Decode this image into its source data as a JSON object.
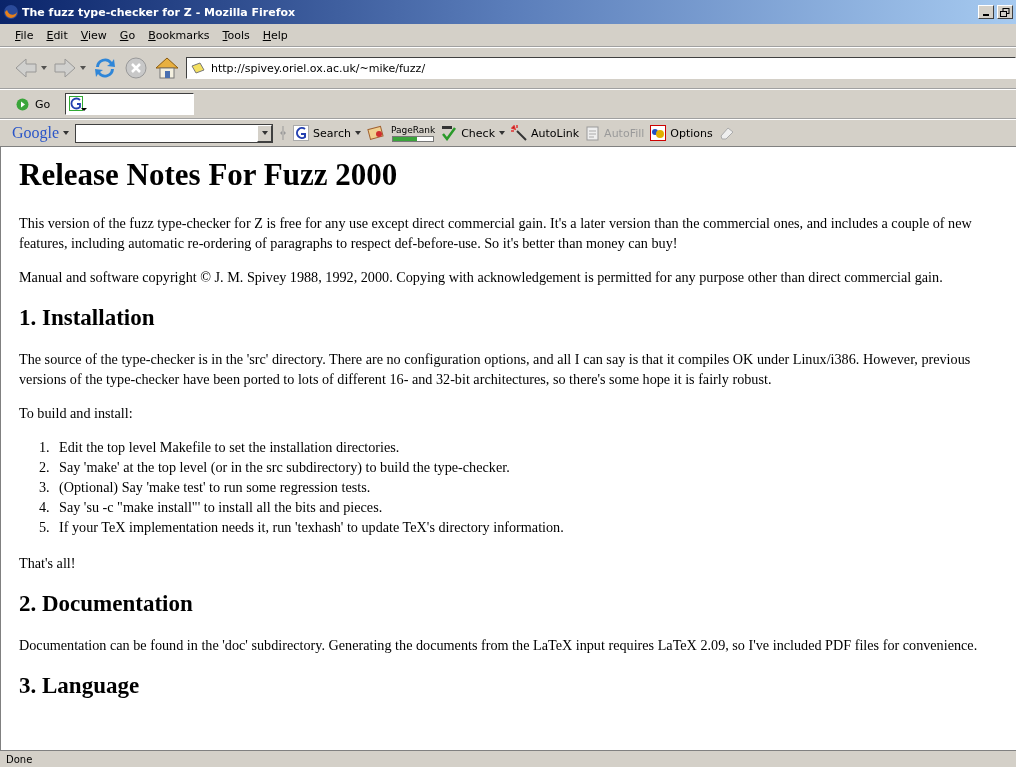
{
  "window": {
    "title": "The fuzz type-checker for Z - Mozilla Firefox"
  },
  "menu": [
    "File",
    "Edit",
    "View",
    "Go",
    "Bookmarks",
    "Tools",
    "Help"
  ],
  "navigation": {
    "back": {
      "disabled": true
    },
    "forward": {
      "disabled": true
    },
    "stop": {
      "disabled": true
    },
    "address": "http://spivey.oriel.ox.ac.uk/~mike/fuzz/"
  },
  "go_bar": {
    "go": "Go"
  },
  "google_toolbar": {
    "logo": "Google",
    "search": "Search",
    "pagerank": {
      "label": "PageRank",
      "level": 0.6
    },
    "buttons": [
      {
        "label": "Check",
        "kind": "check",
        "disabled": false,
        "menu": true
      },
      {
        "label": "AutoLink",
        "kind": "autolink",
        "disabled": false,
        "menu": false
      },
      {
        "label": "AutoFill",
        "kind": "autofill",
        "disabled": true,
        "menu": false
      },
      {
        "label": "Options",
        "kind": "options",
        "disabled": false,
        "menu": false
      }
    ]
  },
  "page": {
    "title": "Release Notes For Fuzz 2000",
    "blocks": [
      {
        "kind": "p",
        "text": "This version of the fuzz type-checker for Z is free for any use except direct commercial gain. It's a later version than the commercial ones, and includes a couple of new features, including automatic re-ordering of paragraphs to respect def-before-use. So it's better than money can buy!"
      },
      {
        "kind": "p",
        "text": "Manual and software copyright © J. M. Spivey 1988, 1992, 2000. Copying with acknowledgement is permitted for any purpose other than direct commercial gain."
      },
      {
        "kind": "h2",
        "text": "1. Installation"
      },
      {
        "kind": "p",
        "text": "The source of the type-checker is in the 'src' directory. There are no configuration options, and all I can say is that it compiles OK under Linux/i386. However, previous versions of the type-checker have been ported to lots of different 16- and 32-bit architectures, so there's some hope it is fairly robust."
      },
      {
        "kind": "p",
        "text": "To build and install:"
      },
      {
        "kind": "ol",
        "items": [
          {
            "number": "1.",
            "text": "Edit the top level Makefile to set the installation directories."
          },
          {
            "number": "2.",
            "text": "Say 'make' at the top level (or in the src subdirectory) to build the type-checker."
          },
          {
            "number": "3.",
            "text": "(Optional) Say 'make test' to run some regression tests."
          },
          {
            "number": "4.",
            "text": "Say 'su -c \"make install\"' to install all the bits and pieces."
          },
          {
            "number": "5.",
            "text": "If your TeX implementation needs it, run 'texhash' to update TeX's directory information."
          }
        ]
      },
      {
        "kind": "p",
        "text": "That's all!"
      },
      {
        "kind": "h2",
        "text": "2. Documentation"
      },
      {
        "kind": "p",
        "text": "Documentation can be found in the 'doc' subdirectory. Generating the documents from the LaTeX input requires LaTeX 2.09, so I've included PDF files for convenience."
      },
      {
        "kind": "h2",
        "text": "3. Language"
      }
    ]
  },
  "status_bar": {
    "text": "Done"
  }
}
